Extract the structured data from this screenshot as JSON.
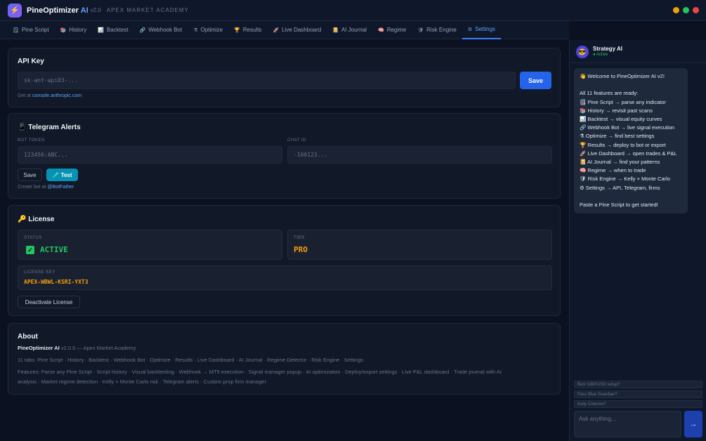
{
  "app": {
    "name": "PineOptimizer",
    "ai": "AI",
    "version": "v2.0",
    "subtitle": "APEX MARKET ACADEMY"
  },
  "tabs": [
    {
      "icon": "pine-script-icon",
      "glyph": "🗒",
      "label": "Pine Script"
    },
    {
      "icon": "history-icon",
      "glyph": "📚",
      "label": "History"
    },
    {
      "icon": "backtest-icon",
      "glyph": "📊",
      "label": "Backtest"
    },
    {
      "icon": "webhook-icon",
      "glyph": "🔗",
      "label": "Webhook Bot"
    },
    {
      "icon": "optimize-icon",
      "glyph": "⚗",
      "label": "Optimize"
    },
    {
      "icon": "trophy-icon",
      "glyph": "🏆",
      "label": "Results"
    },
    {
      "icon": "live-icon",
      "glyph": "🚀",
      "label": "Live Dashboard"
    },
    {
      "icon": "journal-icon",
      "glyph": "📔",
      "label": "AI Journal"
    },
    {
      "icon": "brain-icon",
      "glyph": "🧠",
      "label": "Regime"
    },
    {
      "icon": "shield-icon",
      "glyph": "🛡",
      "label": "Risk Engine"
    },
    {
      "icon": "gear-icon",
      "glyph": "⚙",
      "label": "Settings"
    }
  ],
  "active_tab": "Settings",
  "api_key": {
    "title": "API Key",
    "placeholder": "sk-ant-api03-...",
    "save_label": "Save",
    "hint_prefix": "Get at",
    "hint_link": "console.anthropic.com"
  },
  "telegram": {
    "title": "📱 Telegram Alerts",
    "bot_token_label": "BOT TOKEN",
    "bot_token_placeholder": "123456:ABC...",
    "chat_id_label": "CHAT ID",
    "chat_id_placeholder": "-100123...",
    "save_label": "Save",
    "test_label": "🧪 Test",
    "hint_prefix": "Create bot at",
    "hint_link": "@BotFather"
  },
  "license": {
    "title": "🔑 License",
    "status_label": "STATUS",
    "status_check": "✓",
    "status_value": "ACTIVE",
    "tier_label": "TIER",
    "tier_value": "PRO",
    "key_label": "LICENSE KEY",
    "key_value": "APEX-WBWL-KSRI-YXT3",
    "deactivate_label": "Deactivate License",
    "status_color": "#22c55e",
    "tier_color": "#f59e0b"
  },
  "about": {
    "title": "About",
    "name_strong": "PineOptimizer AI",
    "name_rest": " v2.0.0 — Apex Market Academy",
    "tabs_line": "11 tabs: Pine Script · History · Backtest · Webhook Bot · Optimize · Results · Live Dashboard · AI Journal · Regime Detector · Risk Engine · Settings",
    "features_line1": "Features: Parse any Pine Script · Script history · Visual backtesting · Webhook → MT5 execution · Signal manager popup · AI optimization · Deploy/export settings · Live P&L dashboard · Trade journal with AI",
    "features_line2": "analysis · Market regime detection · Kelly + Monte Carlo risk · Telegram alerts · Custom prop firm manager"
  },
  "chat": {
    "bot_name": "Strategy AI",
    "bot_status": "● Active",
    "lines": [
      "👋 Welcome to PineOptimizer AI v2!",
      "",
      "All 11 features are ready:",
      "🗒 Pine Script → parse any indicator",
      "📚 History → revisit past scans",
      "📊 Backtest → visual equity curves",
      "🔗 Webhook Bot → live signal execution",
      "⚗ Optimize → find best settings",
      "🏆 Results → deploy to bot or export",
      "🚀 Live Dashboard → open trades & P&L",
      "📔 AI Journal → find your patterns",
      "🧠 Regime → when to trade",
      "🛡 Risk Engine → Kelly + Monte Carlo",
      "⚙ Settings → API, Telegram, firms",
      "",
      "Paste a Pine Script to get started!"
    ],
    "suggestions": [
      "Best GBP/USD setup?",
      "Pass Blue Guardian?",
      "Kelly Criterion?"
    ],
    "input_placeholder": "Ask anything...",
    "send_glyph": "→"
  }
}
